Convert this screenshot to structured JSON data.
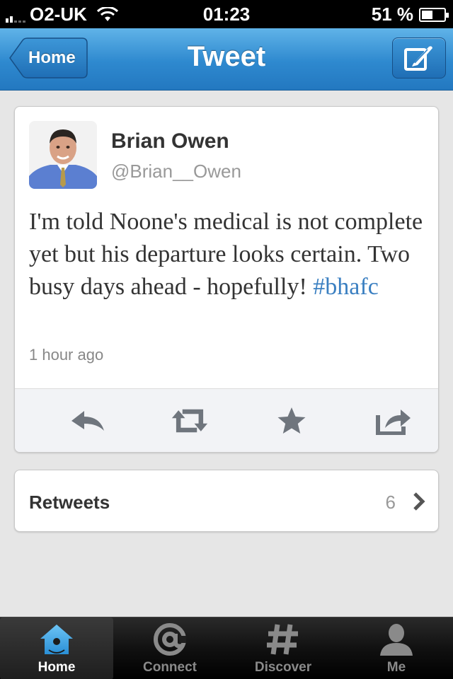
{
  "status_bar": {
    "carrier": "O2-UK",
    "time": "01:23",
    "battery_percent": "51 %",
    "battery_level": 0.51
  },
  "nav": {
    "back_label": "Home",
    "title": "Tweet",
    "compose_icon": "compose-icon"
  },
  "tweet": {
    "author_name": "Brian Owen",
    "author_handle": "@Brian__Owen",
    "text_before_hashtag": "I'm told Noone's medical is not complete yet but his departure looks certain. Two busy days ahead - hopefully! ",
    "hashtag": "#bhafc",
    "timestamp": "1 hour ago",
    "actions": [
      "reply-icon",
      "retweet-icon",
      "favorite-star-icon",
      "share-icon"
    ]
  },
  "retweets": {
    "label": "Retweets",
    "count": "6"
  },
  "tabbar": {
    "tabs": [
      {
        "label": "Home",
        "icon": "home-icon",
        "selected": true
      },
      {
        "label": "Connect",
        "icon": "at-sign-icon",
        "selected": false
      },
      {
        "label": "Discover",
        "icon": "hashtag-icon",
        "selected": false
      },
      {
        "label": "Me",
        "icon": "person-icon",
        "selected": false
      }
    ]
  },
  "colors": {
    "nav_blue": "#2e89cf",
    "hashtag_blue": "#3a7fc1",
    "tab_selected_icon": "#3fa6e8"
  }
}
